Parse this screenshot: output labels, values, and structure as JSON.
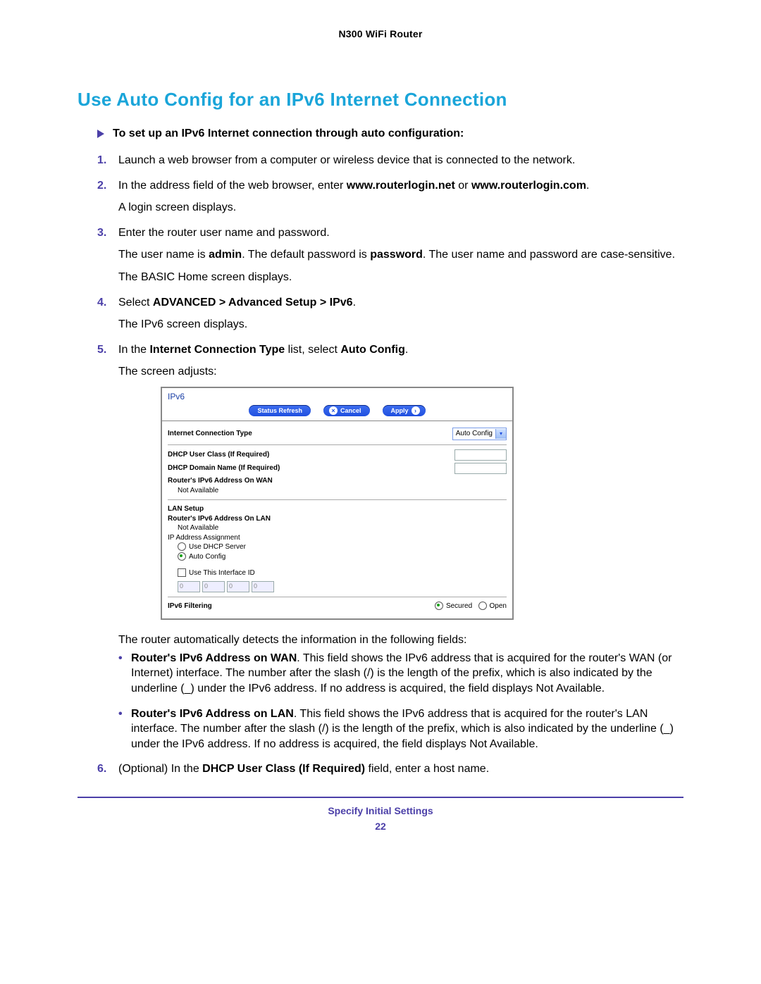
{
  "doc": {
    "header": "N300 WiFi Router",
    "heading": "Use Auto Config for an IPv6 Internet Connection",
    "task": "To set up an IPv6 Internet connection through auto configuration:",
    "steps": {
      "s1": "Launch a web browser from a computer or wireless device that is connected to the network.",
      "s2_a": "In the address field of the web browser, enter ",
      "s2_b": "www.routerlogin.net",
      "s2_c": " or ",
      "s2_d": "www.routerlogin.com",
      "s2_e": ".",
      "s2_f": "A login screen displays.",
      "s3_a": "Enter the router user name and password.",
      "s3_b1": "The user name is ",
      "s3_b2": "admin",
      "s3_b3": ". The default password is ",
      "s3_b4": "password",
      "s3_b5": ". The user name and password are case-sensitive.",
      "s3_c": "The BASIC Home screen displays.",
      "s4_a": "Select ",
      "s4_b": "ADVANCED > Advanced Setup > IPv6",
      "s4_c": ".",
      "s4_d": "The IPv6 screen displays.",
      "s5_a": "In the ",
      "s5_b": "Internet Connection Type",
      "s5_c": " list, select ",
      "s5_d": "Auto Config",
      "s5_e": ".",
      "s5_f": "The screen adjusts:",
      "after_shot": "The router automatically detects the information in the following fields:",
      "b1_a": "Router's IPv6 Address on WAN",
      "b1_b": ". This field shows the IPv6 address that is acquired for the router's WAN (or Internet) interface. The number after the slash (/) is the length of the prefix, which is also indicated by the underline (_) under the IPv6 address. If no address is acquired, the field displays Not Available.",
      "b2_a": "Router's IPv6 Address on LAN",
      "b2_b": ". This field shows the IPv6 address that is acquired for the router's LAN interface. The number after the slash (/) is the length of the prefix, which is also indicated by the underline (_) under the IPv6 address. If no address is acquired, the field displays Not Available.",
      "s6_a": "(Optional) In the ",
      "s6_b": "DHCP User Class (If Required)",
      "s6_c": " field, enter a host name."
    },
    "footer": {
      "section": "Specify Initial Settings",
      "page": "22"
    }
  },
  "ui": {
    "title": "IPv6",
    "buttons": {
      "refresh": "Status Refresh",
      "cancel": "Cancel",
      "apply": "Apply"
    },
    "connType": {
      "label": "Internet Connection Type",
      "value": "Auto Config"
    },
    "dhcpUserClass": "DHCP User Class (If Required)",
    "dhcpDomain": "DHCP Domain Name  (If Required)",
    "wanAddr": "Router's IPv6 Address On WAN",
    "notAvailable": "Not Available",
    "lanSetup": "LAN Setup",
    "lanAddr": "Router's IPv6 Address On LAN",
    "ipAssign": "IP Address Assignment",
    "optDhcp": "Use DHCP Server",
    "optAuto": "Auto Config",
    "useIfId": "Use This Interface ID",
    "id1": "0",
    "id2": "0",
    "id3": "0",
    "id4": "0",
    "filtering": "IPv6 Filtering",
    "secured": "Secured",
    "open": "Open"
  }
}
